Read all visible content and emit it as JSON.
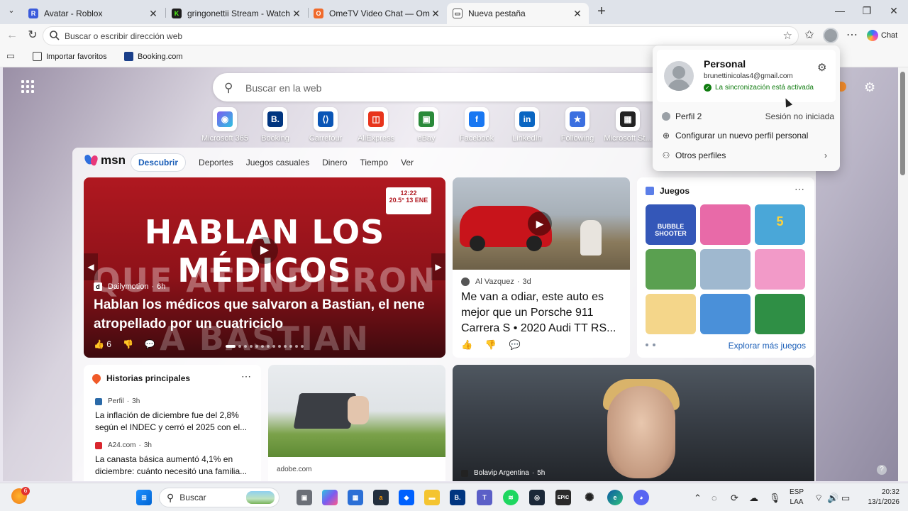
{
  "tabs": [
    {
      "label": "Avatar - Roblox",
      "color": "#3b5bdb",
      "glyph": "R"
    },
    {
      "label": "gringonettii Stream - Watch Live o",
      "color": "#1d1d1d",
      "glyph": "K"
    },
    {
      "label": "OmeTV Video Chat — Omegle Ra",
      "color": "#f06a2b",
      "glyph": "O"
    },
    {
      "label": "Nueva pestaña",
      "color": "#2b6fd6",
      "glyph": "▭"
    }
  ],
  "address_bar": {
    "placeholder": "Buscar o escribir dirección web"
  },
  "chat_label": "Chat",
  "favorites": [
    {
      "label": "Importar favoritos"
    },
    {
      "label": "Booking.com",
      "color": "#1a3f8a"
    }
  ],
  "search": {
    "placeholder": "Buscar en la web"
  },
  "quick_links": [
    {
      "label": "Microsoft 365",
      "color": "#7b5cf0",
      "glyph": "◉"
    },
    {
      "label": "Booking",
      "color": "#003580",
      "glyph": "B."
    },
    {
      "label": "Carrefour",
      "color": "#0a55b6",
      "glyph": "⟨⟩"
    },
    {
      "label": "AliExpress",
      "color": "#e8341c",
      "glyph": "◫"
    },
    {
      "label": "eBay",
      "color": "#2a8a3a",
      "glyph": "▣"
    },
    {
      "label": "Facebook",
      "color": "#1877f2",
      "glyph": "f"
    },
    {
      "label": "LinkedIn",
      "color": "#0a66c2",
      "glyph": "in"
    },
    {
      "label": "Following",
      "color": "#3b6fe0",
      "glyph": "★"
    },
    {
      "label": "Microsoft St...",
      "color": "#222222",
      "glyph": "▦"
    }
  ],
  "msn": {
    "logo": "msn",
    "tabs": [
      "Descubrir",
      "Deportes",
      "Juegos casuales",
      "Dinero",
      "Tiempo",
      "Ver"
    ]
  },
  "hero": {
    "overlay_line1": "HABLAN LOS MÉDICOS",
    "overlay_line2": "QUE ATENDIERON",
    "overlay_line3": "A BASTIAN",
    "badge": "12:22\n20.5°  13 ENE",
    "source": "Dailymotion",
    "age": "6h",
    "title": "Hablan los médicos que salvaron a Bastian, el nene atropellado por un cuatriciclo",
    "likes": "6"
  },
  "card2": {
    "source": "Al Vazquez",
    "age": "3d",
    "title": "Me van a odiar, este auto es mejor que un Porsche 911 Carrera S • 2020 Audi TT RS..."
  },
  "games": {
    "title": "Juegos",
    "explore": "Explorar más juegos",
    "tiles": [
      {
        "name": "bubble-shooter",
        "color": "#3457b8",
        "text": "BUBBLE SHOOTER"
      },
      {
        "name": "makeup",
        "color": "#e86aa8",
        "text": ""
      },
      {
        "name": "shark-5",
        "color": "#4aa7d8",
        "text": "5"
      },
      {
        "name": "cartoon-cook",
        "color": "#5aa050",
        "text": ""
      },
      {
        "name": "stickman",
        "color": "#9fb8cf",
        "text": ""
      },
      {
        "name": "doll",
        "color": "#f29ac8",
        "text": ""
      },
      {
        "name": "cat-tiles",
        "color": "#f4d68a",
        "text": ""
      },
      {
        "name": "blocky",
        "color": "#4a90d9",
        "text": ""
      },
      {
        "name": "mahjong",
        "color": "#2f8f45",
        "text": ""
      }
    ]
  },
  "historias": {
    "title": "Historias principales",
    "items": [
      {
        "source": "Perfil",
        "age": "3h",
        "color": "#2b6aa8",
        "title": "La inflación de diciembre fue del 2,8% según el INDEC y cerró el 2025 con el..."
      },
      {
        "source": "A24.com",
        "age": "3h",
        "color": "#d9262e",
        "title": "La canasta básica aumentó 4,1% en diciembre: cuánto necesitó una familia..."
      }
    ]
  },
  "card4": {
    "source": "adobe.com"
  },
  "card5": {
    "source": "Bolavip Argentina",
    "age": "5h"
  },
  "profile": {
    "name": "Personal",
    "email": "brunettinicolas4@gmail.com",
    "sync": "La sincronización está activada",
    "perfil2": "Perfil 2",
    "perfil2_status": "Sesión no iniciada",
    "new_profile": "Configurar un nuevo perfil personal",
    "other_profiles": "Otros perfiles"
  },
  "taskbar": {
    "search": "Buscar",
    "weather_badge": "6",
    "lang1": "ESP",
    "lang2": "LAA",
    "time": "20:32",
    "date": "13/1/2026"
  }
}
